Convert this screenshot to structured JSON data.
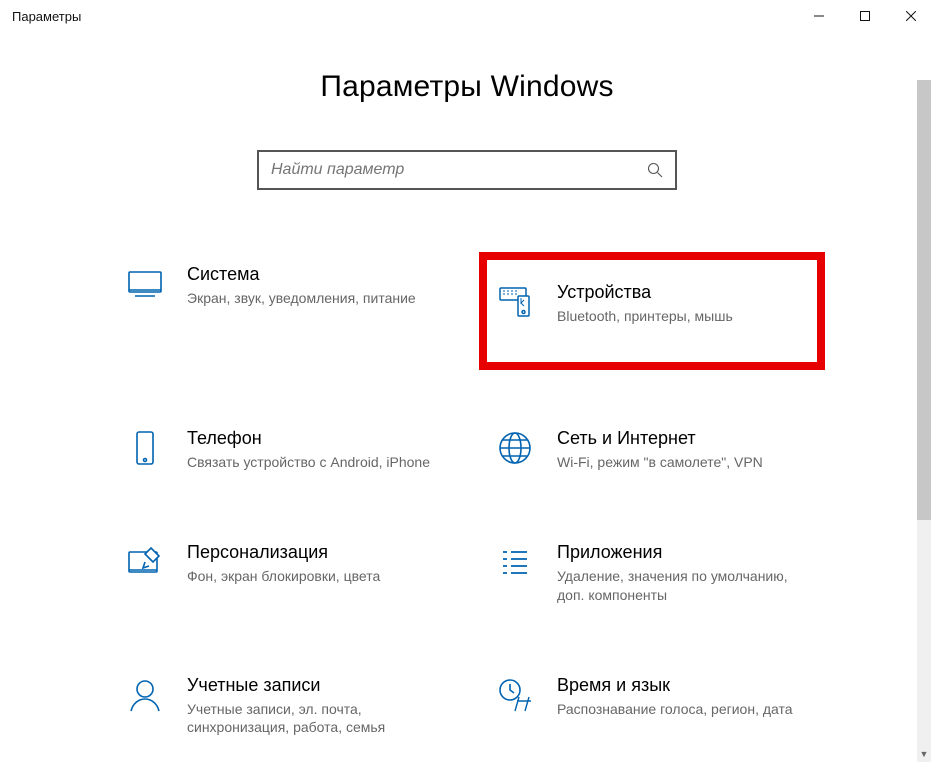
{
  "window": {
    "title": "Параметры"
  },
  "page": {
    "heading": "Параметры Windows"
  },
  "search": {
    "placeholder": "Найти параметр"
  },
  "tiles": {
    "system": {
      "title": "Система",
      "desc": "Экран, звук, уведомления, питание"
    },
    "devices": {
      "title": "Устройства",
      "desc": "Bluetooth, принтеры, мышь"
    },
    "phone": {
      "title": "Телефон",
      "desc": "Связать устройство с Android, iPhone"
    },
    "network": {
      "title": "Сеть и Интернет",
      "desc": "Wi-Fi, режим \"в самолете\", VPN"
    },
    "personalization": {
      "title": "Персонализация",
      "desc": "Фон, экран блокировки, цвета"
    },
    "apps": {
      "title": "Приложения",
      "desc": "Удаление, значения по умолчанию, доп. компоненты"
    },
    "accounts": {
      "title": "Учетные записи",
      "desc": "Учетные записи, эл. почта, синхронизация, работа, семья"
    },
    "timelang": {
      "title": "Время и язык",
      "desc": "Распознавание голоса, регион, дата"
    }
  }
}
